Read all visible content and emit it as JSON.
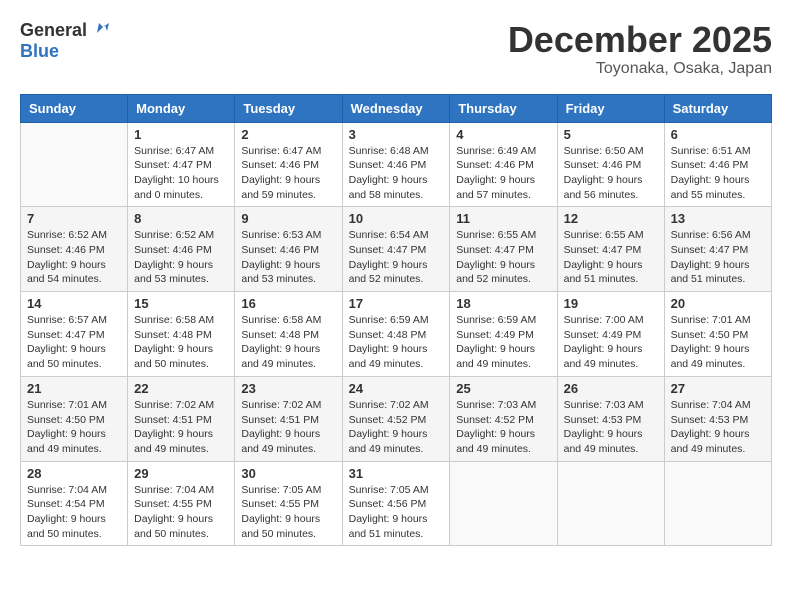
{
  "header": {
    "logo_line1": "General",
    "logo_line2": "Blue",
    "month": "December 2025",
    "location": "Toyonaka, Osaka, Japan"
  },
  "weekdays": [
    "Sunday",
    "Monday",
    "Tuesday",
    "Wednesday",
    "Thursday",
    "Friday",
    "Saturday"
  ],
  "weeks": [
    [
      {
        "day": "",
        "info": ""
      },
      {
        "day": "1",
        "info": "Sunrise: 6:47 AM\nSunset: 4:47 PM\nDaylight: 10 hours\nand 0 minutes."
      },
      {
        "day": "2",
        "info": "Sunrise: 6:47 AM\nSunset: 4:46 PM\nDaylight: 9 hours\nand 59 minutes."
      },
      {
        "day": "3",
        "info": "Sunrise: 6:48 AM\nSunset: 4:46 PM\nDaylight: 9 hours\nand 58 minutes."
      },
      {
        "day": "4",
        "info": "Sunrise: 6:49 AM\nSunset: 4:46 PM\nDaylight: 9 hours\nand 57 minutes."
      },
      {
        "day": "5",
        "info": "Sunrise: 6:50 AM\nSunset: 4:46 PM\nDaylight: 9 hours\nand 56 minutes."
      },
      {
        "day": "6",
        "info": "Sunrise: 6:51 AM\nSunset: 4:46 PM\nDaylight: 9 hours\nand 55 minutes."
      }
    ],
    [
      {
        "day": "7",
        "info": "Sunrise: 6:52 AM\nSunset: 4:46 PM\nDaylight: 9 hours\nand 54 minutes."
      },
      {
        "day": "8",
        "info": "Sunrise: 6:52 AM\nSunset: 4:46 PM\nDaylight: 9 hours\nand 53 minutes."
      },
      {
        "day": "9",
        "info": "Sunrise: 6:53 AM\nSunset: 4:46 PM\nDaylight: 9 hours\nand 53 minutes."
      },
      {
        "day": "10",
        "info": "Sunrise: 6:54 AM\nSunset: 4:47 PM\nDaylight: 9 hours\nand 52 minutes."
      },
      {
        "day": "11",
        "info": "Sunrise: 6:55 AM\nSunset: 4:47 PM\nDaylight: 9 hours\nand 52 minutes."
      },
      {
        "day": "12",
        "info": "Sunrise: 6:55 AM\nSunset: 4:47 PM\nDaylight: 9 hours\nand 51 minutes."
      },
      {
        "day": "13",
        "info": "Sunrise: 6:56 AM\nSunset: 4:47 PM\nDaylight: 9 hours\nand 51 minutes."
      }
    ],
    [
      {
        "day": "14",
        "info": "Sunrise: 6:57 AM\nSunset: 4:47 PM\nDaylight: 9 hours\nand 50 minutes."
      },
      {
        "day": "15",
        "info": "Sunrise: 6:58 AM\nSunset: 4:48 PM\nDaylight: 9 hours\nand 50 minutes."
      },
      {
        "day": "16",
        "info": "Sunrise: 6:58 AM\nSunset: 4:48 PM\nDaylight: 9 hours\nand 49 minutes."
      },
      {
        "day": "17",
        "info": "Sunrise: 6:59 AM\nSunset: 4:48 PM\nDaylight: 9 hours\nand 49 minutes."
      },
      {
        "day": "18",
        "info": "Sunrise: 6:59 AM\nSunset: 4:49 PM\nDaylight: 9 hours\nand 49 minutes."
      },
      {
        "day": "19",
        "info": "Sunrise: 7:00 AM\nSunset: 4:49 PM\nDaylight: 9 hours\nand 49 minutes."
      },
      {
        "day": "20",
        "info": "Sunrise: 7:01 AM\nSunset: 4:50 PM\nDaylight: 9 hours\nand 49 minutes."
      }
    ],
    [
      {
        "day": "21",
        "info": "Sunrise: 7:01 AM\nSunset: 4:50 PM\nDaylight: 9 hours\nand 49 minutes."
      },
      {
        "day": "22",
        "info": "Sunrise: 7:02 AM\nSunset: 4:51 PM\nDaylight: 9 hours\nand 49 minutes."
      },
      {
        "day": "23",
        "info": "Sunrise: 7:02 AM\nSunset: 4:51 PM\nDaylight: 9 hours\nand 49 minutes."
      },
      {
        "day": "24",
        "info": "Sunrise: 7:02 AM\nSunset: 4:52 PM\nDaylight: 9 hours\nand 49 minutes."
      },
      {
        "day": "25",
        "info": "Sunrise: 7:03 AM\nSunset: 4:52 PM\nDaylight: 9 hours\nand 49 minutes."
      },
      {
        "day": "26",
        "info": "Sunrise: 7:03 AM\nSunset: 4:53 PM\nDaylight: 9 hours\nand 49 minutes."
      },
      {
        "day": "27",
        "info": "Sunrise: 7:04 AM\nSunset: 4:53 PM\nDaylight: 9 hours\nand 49 minutes."
      }
    ],
    [
      {
        "day": "28",
        "info": "Sunrise: 7:04 AM\nSunset: 4:54 PM\nDaylight: 9 hours\nand 50 minutes."
      },
      {
        "day": "29",
        "info": "Sunrise: 7:04 AM\nSunset: 4:55 PM\nDaylight: 9 hours\nand 50 minutes."
      },
      {
        "day": "30",
        "info": "Sunrise: 7:05 AM\nSunset: 4:55 PM\nDaylight: 9 hours\nand 50 minutes."
      },
      {
        "day": "31",
        "info": "Sunrise: 7:05 AM\nSunset: 4:56 PM\nDaylight: 9 hours\nand 51 minutes."
      },
      {
        "day": "",
        "info": ""
      },
      {
        "day": "",
        "info": ""
      },
      {
        "day": "",
        "info": ""
      }
    ]
  ]
}
